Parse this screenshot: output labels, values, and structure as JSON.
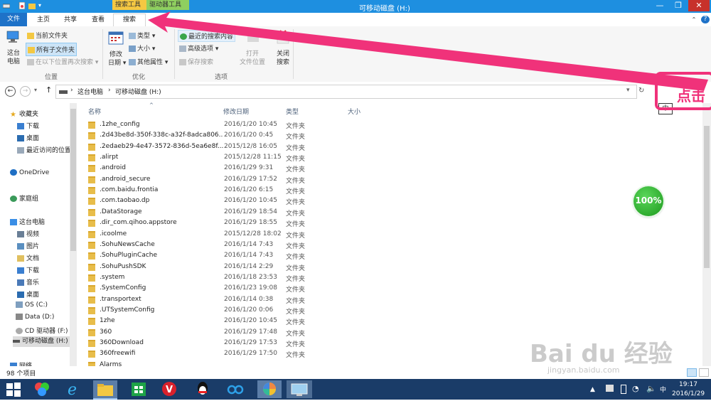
{
  "window": {
    "title": "可移动磁盘 (H:)",
    "context_tabs": [
      "搜索工具",
      "驱动器工具"
    ],
    "controls": {
      "minimize": "—",
      "maximize": "❐",
      "close": "✕"
    }
  },
  "tabs": {
    "file": "文件",
    "home": "主页",
    "share": "共享",
    "view": "查看",
    "search": "搜索",
    "help": "?"
  },
  "ribbon": {
    "location": {
      "this_pc_line1": "这台",
      "this_pc_line2": "电脑",
      "current_folder": "当前文件夹",
      "all_subfolders": "所有子文件夹",
      "search_again": "在以下位置再次搜索",
      "group": "位置"
    },
    "refine": {
      "date_line1": "修改",
      "date_line2": "日期",
      "kind": "类型",
      "size": "大小",
      "other": "其他属性",
      "group": "优化"
    },
    "options": {
      "recent": "最近的搜索内容",
      "advanced": "高级选项",
      "save": "保存搜索",
      "open_line1": "打开",
      "open_line2": "文件位置",
      "close_line1": "关闭",
      "close_line2": "搜索",
      "group": "选项"
    }
  },
  "address": {
    "crumbs": [
      "这台电脑",
      "可移动磁盘 (H:)"
    ]
  },
  "nav": {
    "favorites": "收藏夹",
    "downloads": "下载",
    "desktop": "桌面",
    "recent": "最近访问的位置",
    "onedrive": "OneDrive",
    "homegroup": "家庭组",
    "thispc": "这台电脑",
    "videos": "视频",
    "pictures": "图片",
    "documents": "文档",
    "downloads2": "下载",
    "music": "音乐",
    "desktop2": "桌面",
    "os": "OS (C:)",
    "data": "Data (D:)",
    "cd": "CD 驱动器 (F:)",
    "removable": "可移动磁盘 (H:)",
    "network": "网络"
  },
  "columns": {
    "name": "名称",
    "date": "修改日期",
    "type": "类型",
    "size": "大小"
  },
  "files": [
    {
      "name": ".1zhe_config",
      "date": "2016/1/20 10:45",
      "type": "文件夹"
    },
    {
      "name": ".2d43be8d-350f-338c-a32f-8adca806...",
      "date": "2016/1/20 0:45",
      "type": "文件夹"
    },
    {
      "name": ".2edaeb29-4e47-3572-836d-5ea6e8f...",
      "date": "2015/12/8 16:05",
      "type": "文件夹"
    },
    {
      "name": ".alirpt",
      "date": "2015/12/28 11:15",
      "type": "文件夹"
    },
    {
      "name": ".android",
      "date": "2016/1/29 9:31",
      "type": "文件夹"
    },
    {
      "name": ".android_secure",
      "date": "2016/1/29 17:52",
      "type": "文件夹"
    },
    {
      "name": ".com.baidu.frontia",
      "date": "2016/1/20 6:15",
      "type": "文件夹"
    },
    {
      "name": ".com.taobao.dp",
      "date": "2016/1/20 10:45",
      "type": "文件夹"
    },
    {
      "name": ".DataStorage",
      "date": "2016/1/29 18:54",
      "type": "文件夹"
    },
    {
      "name": ".dir_com.qihoo.appstore",
      "date": "2016/1/29 18:55",
      "type": "文件夹"
    },
    {
      "name": ".icoolme",
      "date": "2015/12/28 18:02",
      "type": "文件夹"
    },
    {
      "name": ".SohuNewsCache",
      "date": "2016/1/14 7:43",
      "type": "文件夹"
    },
    {
      "name": ".SohuPluginCache",
      "date": "2016/1/14 7:43",
      "type": "文件夹"
    },
    {
      "name": ".SohuPushSDK",
      "date": "2016/1/14 2:29",
      "type": "文件夹"
    },
    {
      "name": ".system",
      "date": "2016/1/18 23:53",
      "type": "文件夹"
    },
    {
      "name": ".SystemConfig",
      "date": "2016/1/23 19:08",
      "type": "文件夹"
    },
    {
      "name": ".transportext",
      "date": "2016/1/14 0:38",
      "type": "文件夹"
    },
    {
      "name": ".UTSystemConfig",
      "date": "2016/1/20 0:06",
      "type": "文件夹"
    },
    {
      "name": "1zhe",
      "date": "2016/1/20 10:45",
      "type": "文件夹"
    },
    {
      "name": "360",
      "date": "2016/1/29 17:48",
      "type": "文件夹"
    },
    {
      "name": "360Download",
      "date": "2016/1/29 17:53",
      "type": "文件夹"
    },
    {
      "name": "360freewifi",
      "date": "2016/1/29 17:50",
      "type": "文件夹"
    },
    {
      "name": "Alarms",
      "date": "",
      "type": ""
    }
  ],
  "status": {
    "count": "98 个项目"
  },
  "overlay": {
    "battery": "100%",
    "annotation": "点击",
    "ime": "中"
  },
  "taskbar": {
    "time": "19:17",
    "date": "2016/1/29",
    "ime": "中"
  },
  "watermark": {
    "main": "Bai du 经验",
    "sub": "jingyan.baidu.com"
  },
  "colors": {
    "accent": "#1e72c8",
    "annotation": "#f0327a",
    "context_search": "#f5c842",
    "context_drive": "#8fcf5f",
    "taskbar": "#1a3c68"
  }
}
